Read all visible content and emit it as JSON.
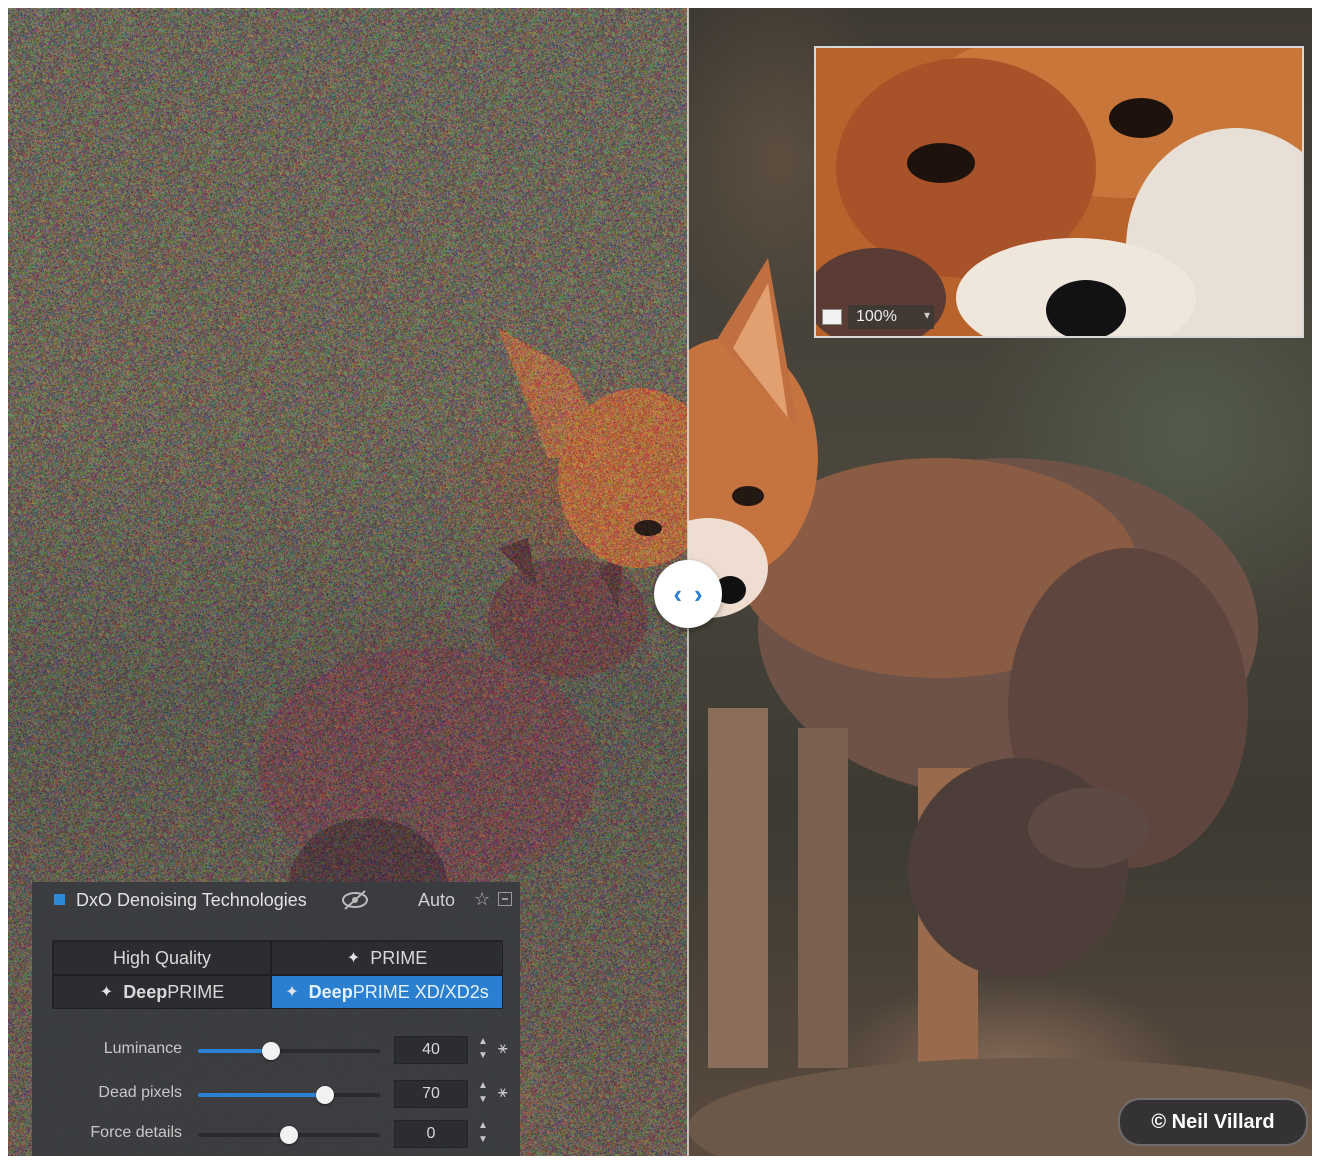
{
  "panel": {
    "title": "DxO Denoising Technologies",
    "auto_label": "Auto",
    "accent_color": "#2b7fd1",
    "methods": {
      "high_quality": "High Quality",
      "prime": "PRIME",
      "deepprime_deep": "Deep",
      "deepprime_rest": "PRIME",
      "deepprime_xd_deep": "Deep",
      "deepprime_xd_rest": "PRIME XD/XD2s",
      "selected": "DeepPRIME XD/XD2s"
    },
    "sliders": [
      {
        "label": "Luminance",
        "value": "40",
        "level": 0.4
      },
      {
        "label": "Dead pixels",
        "value": "70",
        "level": 0.7
      },
      {
        "label": "Force details",
        "value": "0",
        "level": 0.5
      }
    ],
    "icons": [
      "eye-slash-icon",
      "star-icon",
      "panel-menu-icon",
      "magic-wand-icon",
      "stepper-icon",
      "sparkle-icon"
    ]
  },
  "loupe": {
    "zoom": "100%"
  },
  "compare": {
    "left_glyph": "‹",
    "right_glyph": "›"
  },
  "credit": {
    "text": "© Neil Villard"
  }
}
